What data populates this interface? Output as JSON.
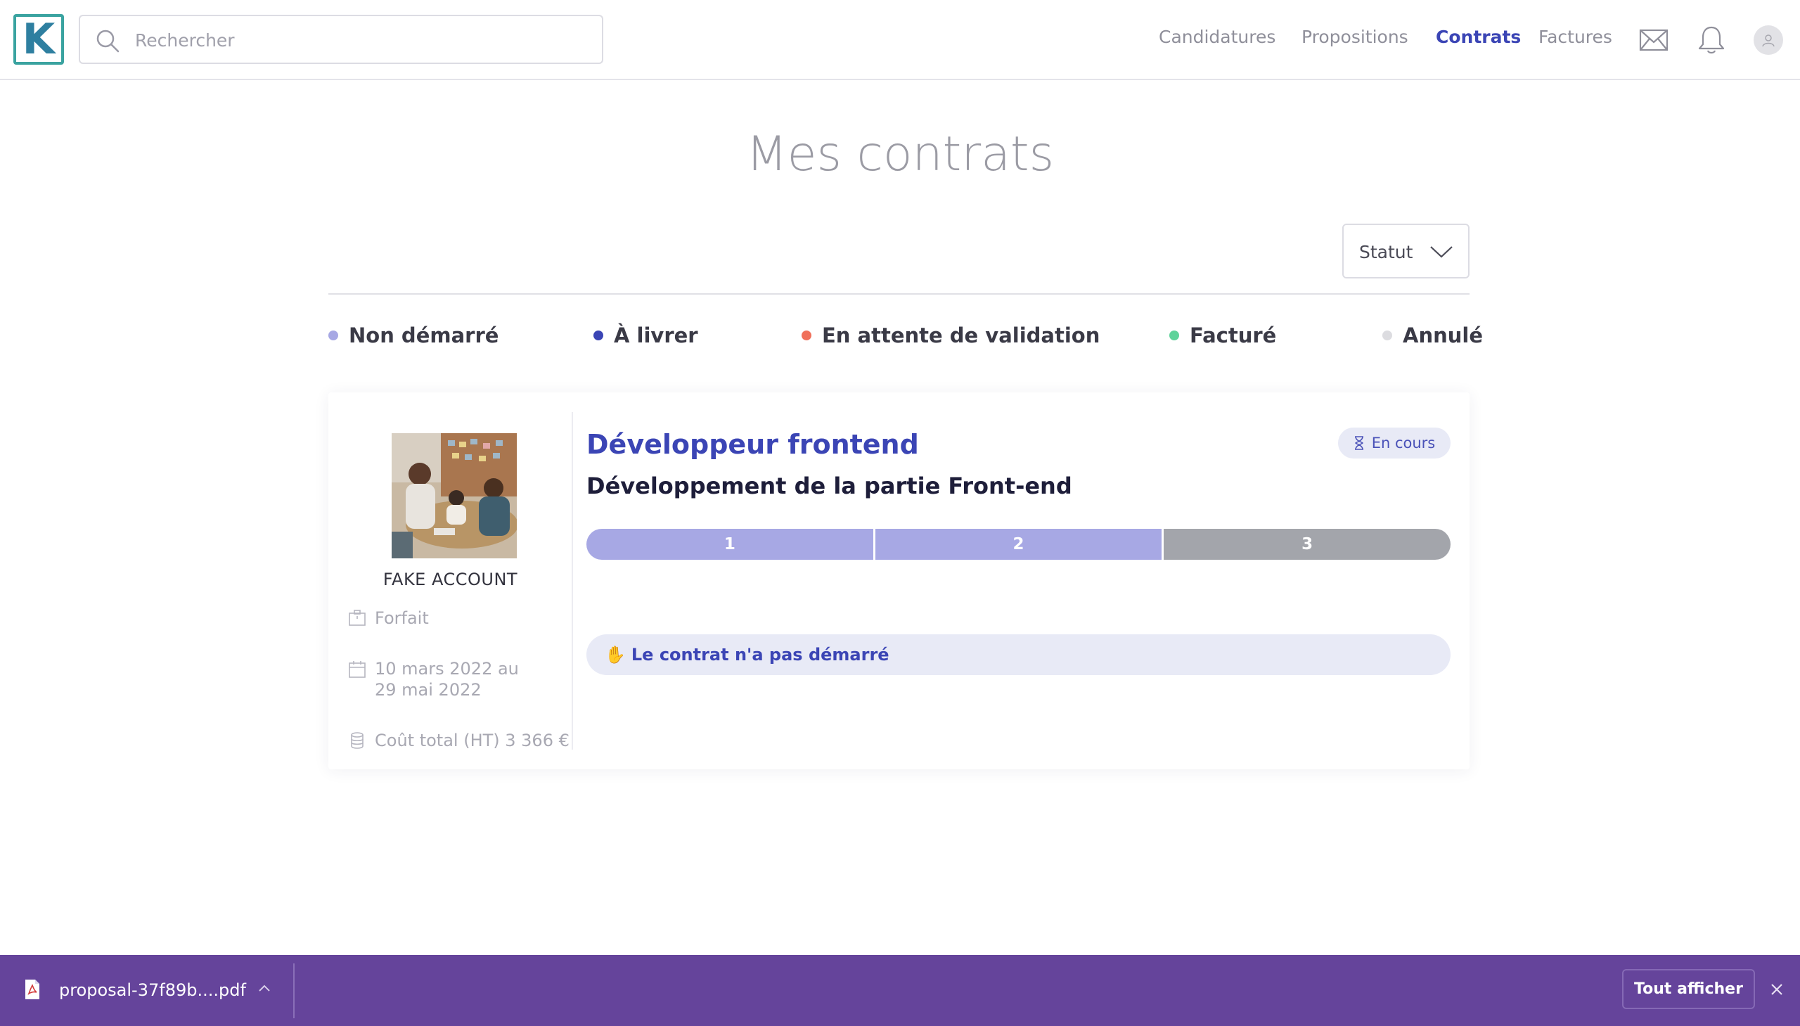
{
  "header": {
    "logo_letter": "K",
    "search_placeholder": "Rechercher",
    "nav": [
      {
        "label": "Candidatures",
        "active": false
      },
      {
        "label": "Propositions",
        "active": false
      },
      {
        "label": "Contrats",
        "active": true
      },
      {
        "label": "Factures",
        "active": false
      }
    ],
    "icons": [
      "search-icon",
      "mail-icon",
      "bell-icon",
      "avatar-icon"
    ],
    "accent_color": "#3b45b5"
  },
  "main": {
    "title": "Mes contrats",
    "filter_label": "Statut",
    "legend": [
      {
        "label": "Non démarré",
        "color": "#a7a8e4"
      },
      {
        "label": "À livrer",
        "color": "#3b45b5"
      },
      {
        "label": "En attente de validation",
        "color": "#f0705a"
      },
      {
        "label": "Facturé",
        "color": "#5fd39a"
      },
      {
        "label": "Annulé",
        "color": "#dcdce0"
      }
    ]
  },
  "contract": {
    "account_name": "FAKE ACCOUNT",
    "pricing": "Forfait",
    "dates": "10 mars 2022 au\n29 mai 2022",
    "dates_line1": "10 mars 2022 au",
    "dates_line2": "29 mai 2022",
    "total_cost": "Coût total (HT) 3 366 €",
    "job_title": "Développeur frontend",
    "subtitle": "Développement de la partie Front-end",
    "status_badge": "En cours",
    "steps": [
      {
        "label": "1",
        "state": "done"
      },
      {
        "label": "2",
        "state": "done"
      },
      {
        "label": "3",
        "state": "todo"
      }
    ],
    "notice_emoji": "✋",
    "notice": "Le contrat n'a pas démarré"
  },
  "download_bar": {
    "filename": "proposal-37f89b....pdf",
    "show_all": "Tout afficher",
    "bg_color": "#65449b"
  }
}
